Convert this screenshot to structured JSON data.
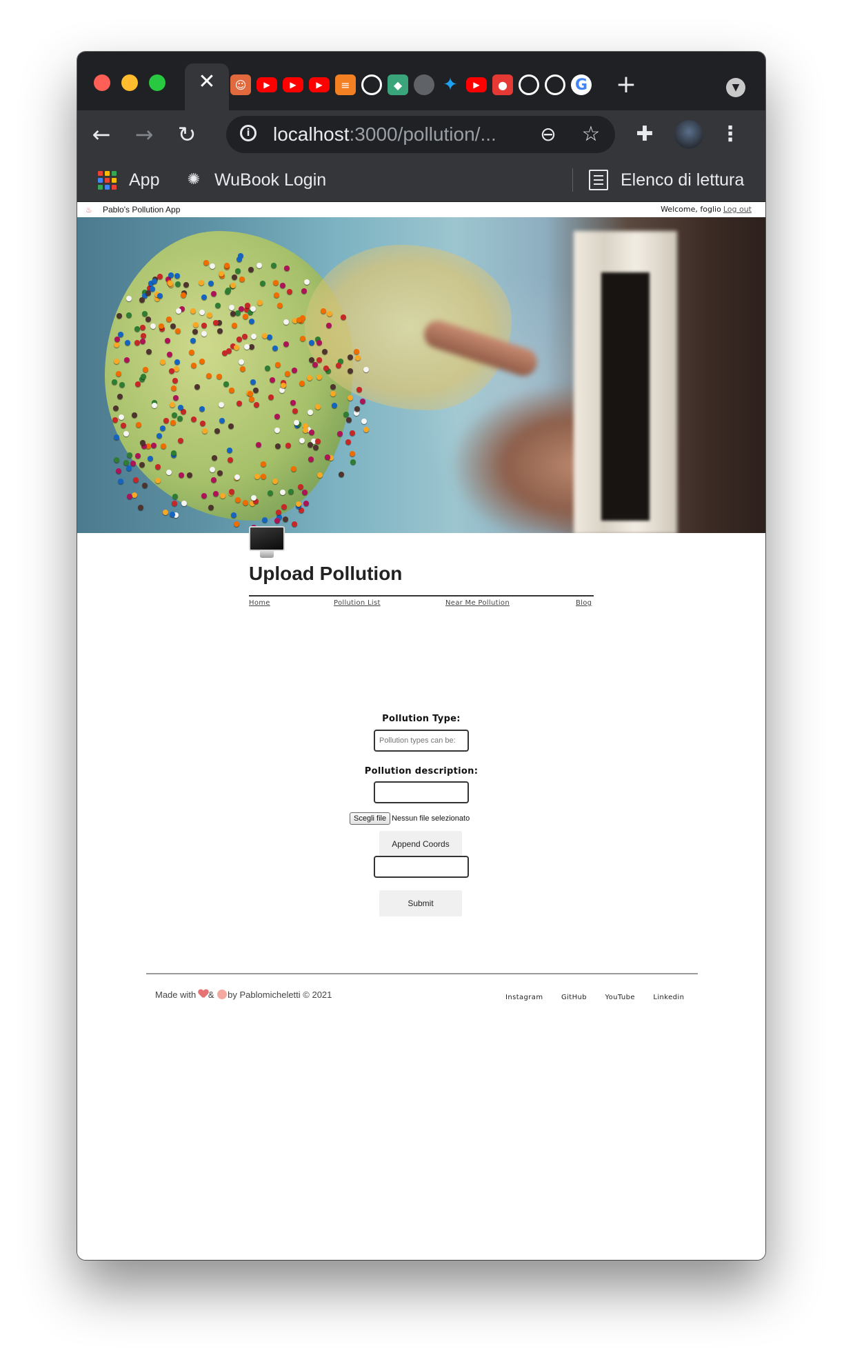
{
  "browser": {
    "active_tab_close": "✕",
    "new_tab": "+",
    "url_host": "localhost",
    "url_path": ":3000/pollution/...",
    "bookmarks": {
      "apps_label": "App",
      "wubook_label": "WuBook Login",
      "reading_list_label": "Elenco di lettura"
    },
    "favicon_names": [
      "app-icon",
      "youtube-icon",
      "youtube-icon",
      "youtube-icon",
      "stackoverflow-icon",
      "github-icon",
      "shield-icon",
      "globe-icon",
      "twitter-icon",
      "youtube-icon",
      "user-icon",
      "github-icon",
      "github-icon",
      "google-icon"
    ]
  },
  "topbar": {
    "app_name": "Pablo's Pollution App",
    "welcome": "Welcome, foglio",
    "logout": "Log out"
  },
  "page": {
    "title": "Upload Pollution",
    "nav": {
      "home": "Home",
      "pollution_list": "Pollution List",
      "near_me": "Near Me Pollution",
      "blog": "Blog"
    }
  },
  "form": {
    "type_label": "Pollution Type:",
    "type_placeholder": "Pollution types can be:",
    "description_label": "Pollution description:",
    "description_value": "",
    "file_button": "Scegli file",
    "file_status": "Nessun file selezionato",
    "append_coords": "Append Coords",
    "coords_value": "",
    "submit": "Submit"
  },
  "footer": {
    "made_with": "Made with",
    "amp": "&",
    "by": "by Pablomicheletti © 2021",
    "links": [
      "Instagram",
      "GitHub",
      "YouTube",
      "Linkedin"
    ]
  },
  "colors": {
    "chrome_dark": "#202124",
    "chrome_toolbar": "#35363a",
    "page_text": "#222222"
  }
}
